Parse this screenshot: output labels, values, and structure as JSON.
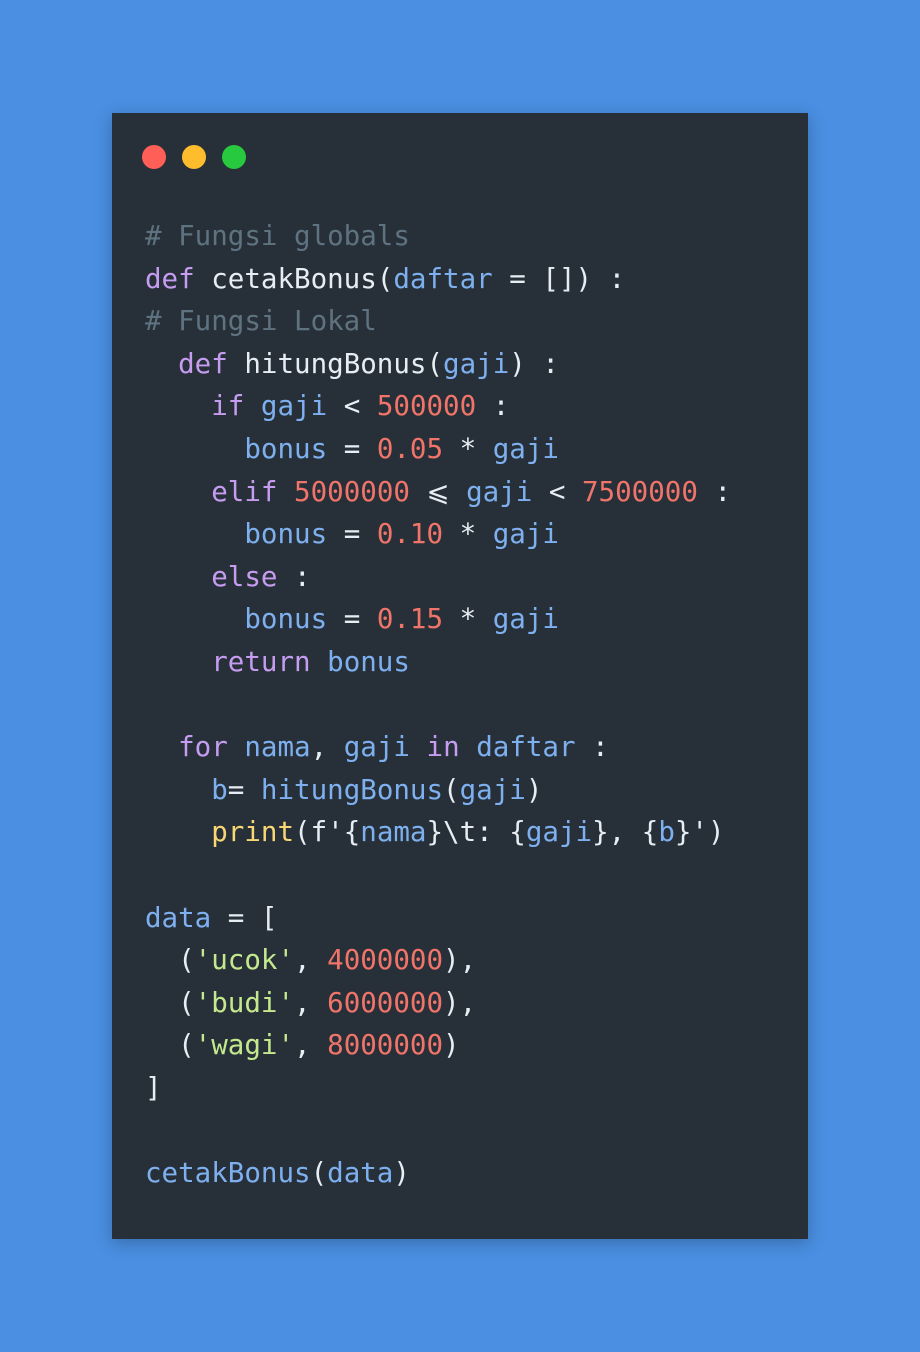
{
  "window": {
    "controls": [
      {
        "name": "close",
        "color": "#ff5f56"
      },
      {
        "name": "minimize",
        "color": "#ffbd2e"
      },
      {
        "name": "maximize",
        "color": "#27c93f"
      }
    ]
  },
  "theme": {
    "background": "#4a8fe2",
    "editor_bg": "#273038",
    "comment": "#5f7280",
    "keyword": "#c69cf0",
    "name": "#7eb0f0",
    "text": "#e6edf3",
    "number": "#f0746a",
    "string": "#c3e88d",
    "builtin": "#f7d774"
  },
  "code": {
    "lines": [
      [
        {
          "t": "# Fungsi globals",
          "k": "comment"
        }
      ],
      [
        {
          "t": "def",
          "k": "keyword"
        },
        {
          "t": " cetakBonus(",
          "k": "text"
        },
        {
          "t": "daftar",
          "k": "name"
        },
        {
          "t": " = []) :",
          "k": "text"
        }
      ],
      [
        {
          "t": "# Fungsi Lokal",
          "k": "comment"
        }
      ],
      [
        {
          "t": "  ",
          "k": "text"
        },
        {
          "t": "def",
          "k": "keyword"
        },
        {
          "t": " hitungBonus(",
          "k": "text"
        },
        {
          "t": "gaji",
          "k": "name"
        },
        {
          "t": ") :",
          "k": "text"
        }
      ],
      [
        {
          "t": "    ",
          "k": "text"
        },
        {
          "t": "if",
          "k": "keyword"
        },
        {
          "t": " ",
          "k": "text"
        },
        {
          "t": "gaji",
          "k": "name"
        },
        {
          "t": " < ",
          "k": "text"
        },
        {
          "t": "500000",
          "k": "number"
        },
        {
          "t": " :",
          "k": "text"
        }
      ],
      [
        {
          "t": "      ",
          "k": "text"
        },
        {
          "t": "bonus",
          "k": "name"
        },
        {
          "t": " = ",
          "k": "text"
        },
        {
          "t": "0.05",
          "k": "number"
        },
        {
          "t": " * ",
          "k": "text"
        },
        {
          "t": "gaji",
          "k": "name"
        }
      ],
      [
        {
          "t": "    ",
          "k": "text"
        },
        {
          "t": "elif",
          "k": "keyword"
        },
        {
          "t": " ",
          "k": "text"
        },
        {
          "t": "5000000",
          "k": "number"
        },
        {
          "t": " ⩽ ",
          "k": "text"
        },
        {
          "t": "gaji",
          "k": "name"
        },
        {
          "t": " < ",
          "k": "text"
        },
        {
          "t": "7500000",
          "k": "number"
        },
        {
          "t": " :",
          "k": "text"
        }
      ],
      [
        {
          "t": "      ",
          "k": "text"
        },
        {
          "t": "bonus",
          "k": "name"
        },
        {
          "t": " = ",
          "k": "text"
        },
        {
          "t": "0.10",
          "k": "number"
        },
        {
          "t": " * ",
          "k": "text"
        },
        {
          "t": "gaji",
          "k": "name"
        }
      ],
      [
        {
          "t": "    ",
          "k": "text"
        },
        {
          "t": "else",
          "k": "keyword"
        },
        {
          "t": " :",
          "k": "text"
        }
      ],
      [
        {
          "t": "      ",
          "k": "text"
        },
        {
          "t": "bonus",
          "k": "name"
        },
        {
          "t": " = ",
          "k": "text"
        },
        {
          "t": "0.15",
          "k": "number"
        },
        {
          "t": " * ",
          "k": "text"
        },
        {
          "t": "gaji",
          "k": "name"
        }
      ],
      [
        {
          "t": "    ",
          "k": "text"
        },
        {
          "t": "return",
          "k": "keyword"
        },
        {
          "t": " ",
          "k": "text"
        },
        {
          "t": "bonus",
          "k": "name"
        }
      ],
      [],
      [
        {
          "t": "  ",
          "k": "text"
        },
        {
          "t": "for",
          "k": "keyword"
        },
        {
          "t": " ",
          "k": "text"
        },
        {
          "t": "nama",
          "k": "name"
        },
        {
          "t": ", ",
          "k": "text"
        },
        {
          "t": "gaji",
          "k": "name"
        },
        {
          "t": " ",
          "k": "text"
        },
        {
          "t": "in",
          "k": "keyword"
        },
        {
          "t": " ",
          "k": "text"
        },
        {
          "t": "daftar",
          "k": "name"
        },
        {
          "t": " :",
          "k": "text"
        }
      ],
      [
        {
          "t": "    ",
          "k": "text"
        },
        {
          "t": "b",
          "k": "name"
        },
        {
          "t": "= ",
          "k": "text"
        },
        {
          "t": "hitungBonus",
          "k": "name"
        },
        {
          "t": "(",
          "k": "text"
        },
        {
          "t": "gaji",
          "k": "name"
        },
        {
          "t": ")",
          "k": "text"
        }
      ],
      [
        {
          "t": "    ",
          "k": "text"
        },
        {
          "t": "print",
          "k": "builtin"
        },
        {
          "t": "(f'{",
          "k": "text"
        },
        {
          "t": "nama",
          "k": "name"
        },
        {
          "t": "}\\t: {",
          "k": "text"
        },
        {
          "t": "gaji",
          "k": "name"
        },
        {
          "t": "}, {",
          "k": "text"
        },
        {
          "t": "b",
          "k": "name"
        },
        {
          "t": "}')",
          "k": "text"
        }
      ],
      [],
      [
        {
          "t": "data",
          "k": "name"
        },
        {
          "t": " = [",
          "k": "text"
        }
      ],
      [
        {
          "t": "  (",
          "k": "text"
        },
        {
          "t": "'ucok'",
          "k": "string"
        },
        {
          "t": ", ",
          "k": "text"
        },
        {
          "t": "4000000",
          "k": "number"
        },
        {
          "t": "),",
          "k": "text"
        }
      ],
      [
        {
          "t": "  (",
          "k": "text"
        },
        {
          "t": "'budi'",
          "k": "string"
        },
        {
          "t": ", ",
          "k": "text"
        },
        {
          "t": "6000000",
          "k": "number"
        },
        {
          "t": "),",
          "k": "text"
        }
      ],
      [
        {
          "t": "  (",
          "k": "text"
        },
        {
          "t": "'wagi'",
          "k": "string"
        },
        {
          "t": ", ",
          "k": "text"
        },
        {
          "t": "8000000",
          "k": "number"
        },
        {
          "t": ")",
          "k": "text"
        }
      ],
      [
        {
          "t": "]",
          "k": "text"
        }
      ],
      [],
      [
        {
          "t": "cetakBonus",
          "k": "name"
        },
        {
          "t": "(",
          "k": "text"
        },
        {
          "t": "data",
          "k": "name"
        },
        {
          "t": ")",
          "k": "text"
        }
      ]
    ]
  }
}
